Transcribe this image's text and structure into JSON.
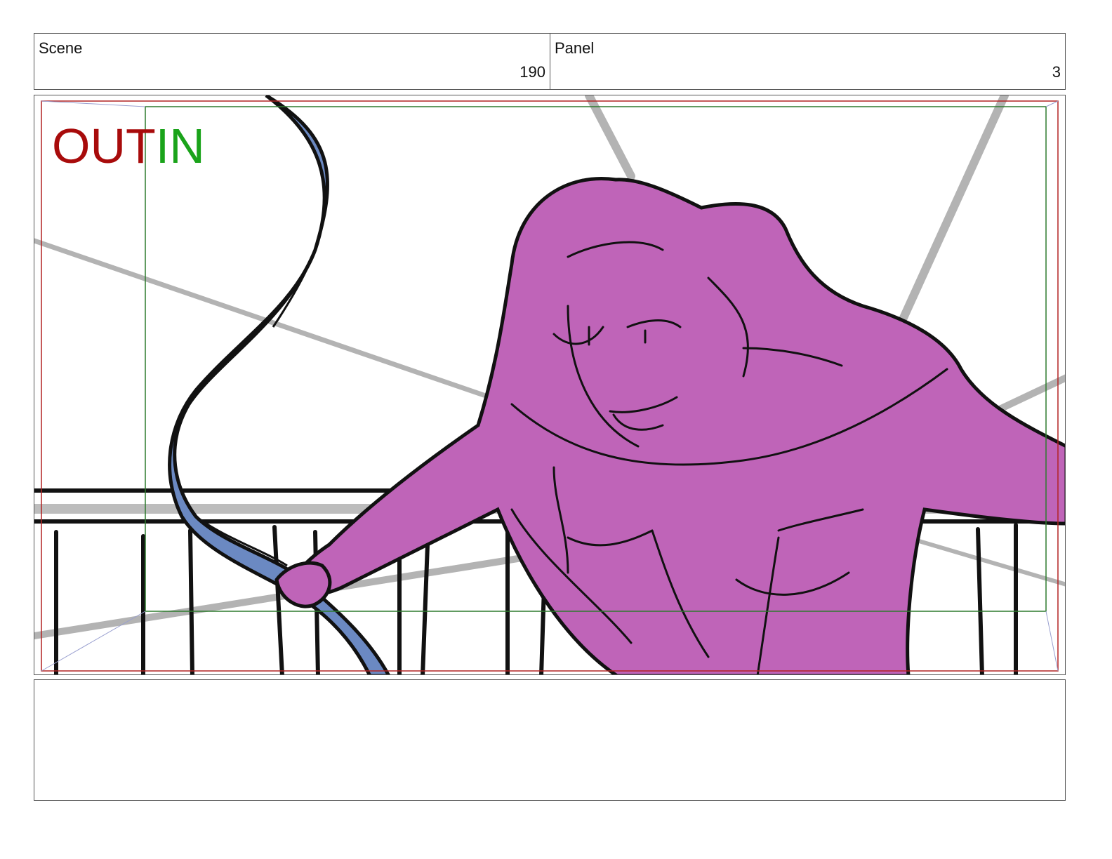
{
  "header": {
    "scene_label": "Scene",
    "scene_number": "190",
    "panel_label": "Panel",
    "panel_number": "3"
  },
  "frame": {
    "out_label": "OUT",
    "in_label": "IN",
    "out_color": "#a80b0b",
    "in_color": "#1aa31a",
    "figure_color": "#bf64b8",
    "ribbon_color": "#6b89c2"
  },
  "notes": {
    "text": ""
  }
}
